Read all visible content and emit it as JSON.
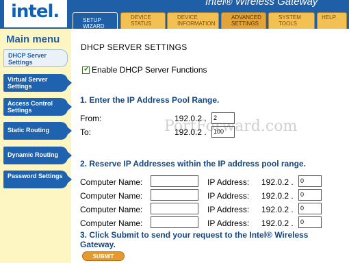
{
  "header": {
    "logo_text": "intel.",
    "title": "Intel® Wireless Gateway",
    "tabs": [
      "SETUP WIZARD",
      "DEVICE STATUS",
      "DEVICE INFORMATION",
      "ADVANCED SETTINGS",
      "SYSTEM TOOLS",
      "HELP"
    ]
  },
  "sidebar": {
    "title": "Main menu",
    "items": [
      "DHCP Server Settings",
      "Virtual Server Settings",
      "Access Control Settings",
      "Static Routing",
      "Dynamic Routing",
      "Password Settings"
    ]
  },
  "main": {
    "title": "DHCP SERVER SETTINGS",
    "enable_label": "Enable DHCP Server Functions",
    "section1": "1. Enter the IP Address Pool Range.",
    "from_label": "From:",
    "to_label": "To:",
    "ip_prefix": "192.0.2 .",
    "from_value": "2",
    "to_value": "100",
    "section2": "2. Reserve IP Addresses within the IP address pool range.",
    "computer_name_label": "Computer Name:",
    "ip_address_label": "IP Address:",
    "reserve_values": [
      "0",
      "0",
      "0",
      "0"
    ],
    "section3": "3. Click Submit to send your request to the Intel® Wireless Gateway.",
    "submit_label": "SUBMIT"
  },
  "watermark": "PortForward.com"
}
